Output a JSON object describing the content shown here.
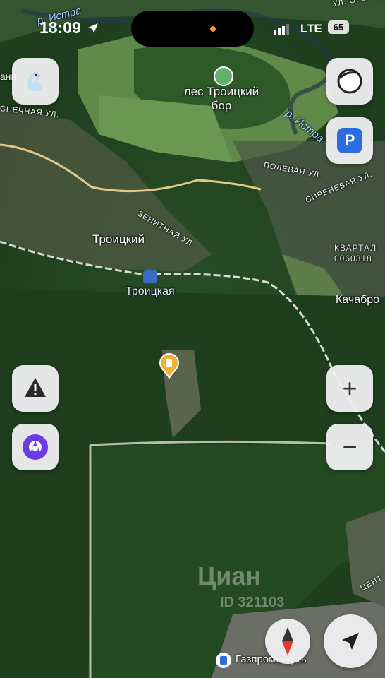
{
  "status_bar": {
    "time": "18:09",
    "network": "LTE",
    "battery": "65"
  },
  "map": {
    "labels": {
      "river_top": "р. Истра",
      "river_right": "р. Истра",
      "forest_line1": "лес Троицкий",
      "forest_line2": "бор",
      "settlement": "Троицкий",
      "station": "Троицкая",
      "kvartal_line1": "КВАРТАЛ",
      "kvartal_line2": "0060318",
      "kachabrovo": "Качабро",
      "fuel_station": "Газпромнефть"
    },
    "streets": {
      "ogorodnaya": "УЛ. ОГОРОД",
      "sosnovaya": "СНЕЧНАЯ УЛ.",
      "polevaya": "ПОЛЕВАЯ УЛ.",
      "sirenevaya": "СИРЕНЕВАЯ УЛ.",
      "zenitnaya": "ЗЕНИТНАЯ УЛ.",
      "centralnaya": "ЦЕНТ"
    },
    "edge_fragment": "анн",
    "watermark": "Циан",
    "watermark_id": "ID 321103"
  },
  "controls": {
    "zoom_in": "+",
    "zoom_out": "−"
  },
  "colors": {
    "accent_blue": "#2b6de0",
    "alice_purple": "#6c3be8",
    "pin_yellow": "#f2b233",
    "compass_red": "#e0382a"
  }
}
